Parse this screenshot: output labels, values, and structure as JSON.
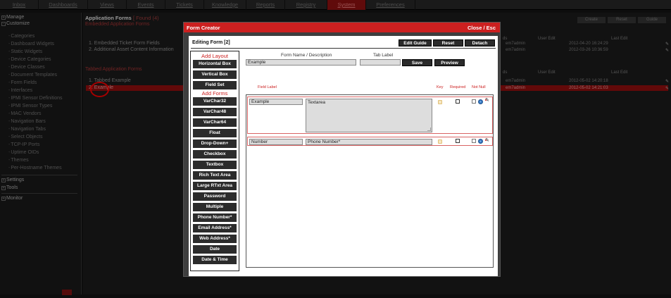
{
  "nav": [
    "Inbox",
    "Dashboards",
    "Views",
    "Events",
    "Tickets",
    "Knowledge",
    "Reports",
    "Registry",
    "System",
    "Preferences"
  ],
  "sidebar": {
    "manage": "Manage",
    "customize": "Customize",
    "items": [
      "Categories",
      "Dashboard Widgets",
      "Static Widgets",
      "Device Categories",
      "Device Classes",
      "Document Templates",
      "Form Fields",
      "Interfaces",
      "IPMI Sensor Definitions",
      "IPMI Sensor Types",
      "MAC Vendors",
      "Navigation Bars",
      "Navigation Tabs",
      "Select Objects",
      "TCP-IP Ports",
      "Uptime OIDs",
      "Themes",
      "Per-Hostname Themes"
    ],
    "settings": "Settings",
    "tools": "Tools",
    "monitor": "Monitor"
  },
  "main": {
    "title": "Application Forms",
    "found": "[ Found (4)",
    "embedded_header": "Embedded Application Forms",
    "embedded_rows": [
      "1. Embedded Ticket Form Fields",
      "2. Additional Asset Content Information"
    ],
    "tabbed_header": "Tabbed Application Forms",
    "tabbed_rows": [
      "1. Tabbed Example",
      "2. Example"
    ],
    "buttons": [
      "Create",
      "Reset",
      "Guide"
    ],
    "col_user_edit": "User Edit",
    "col_last_edit": "Last Edit",
    "col_ds": "ds",
    "embedded_users": [
      "em7admin",
      "em7admin"
    ],
    "embedded_dates": [
      "2012-04-20 16:24:29",
      "2012-03-26 10:36:59"
    ],
    "tabbed_users": [
      "em7admin",
      "em7admin"
    ],
    "tabbed_dates": [
      "2012-05-02 14:20:18",
      "2012-05-02 14:21:03"
    ]
  },
  "modal": {
    "title": "Form Creator",
    "close": "Close / Esc",
    "editing": "Editing Form [2]",
    "top_buttons": [
      "Edit Guide",
      "Reset",
      "Detach"
    ],
    "form_name_label": "Form Name / Description",
    "tab_label_label": "Tab Label",
    "form_name_value": "Example",
    "tab_label_value": "",
    "save": "Save",
    "preview": "Preview",
    "col_field_label": "Field Label",
    "col_key": "Key",
    "col_required": "Required",
    "col_not_null": "Not Null",
    "fields": [
      {
        "label": "Example",
        "type": "Textarea"
      },
      {
        "label": "Number",
        "type": "Phone Number*"
      }
    ]
  },
  "toolbox": {
    "layout_title": "Add Layout",
    "layout": [
      "Horizontal Box",
      "Vertical Box",
      "Field Set"
    ],
    "forms_title": "Add Forms",
    "forms": [
      "VarChar32",
      "VarChar48",
      "VarChar64",
      "Float",
      "Drop-Down+",
      "Checkbox",
      "Textbox",
      "Rich Text Area",
      "Large RTxt Area",
      "Password",
      "Multiple",
      "Phone Number*",
      "Email Address*",
      "Web Address*",
      "Date",
      "Date & Time"
    ]
  },
  "colors": {
    "accent": "#cc2020",
    "button": "#2b2b2b",
    "background": "#141414"
  }
}
